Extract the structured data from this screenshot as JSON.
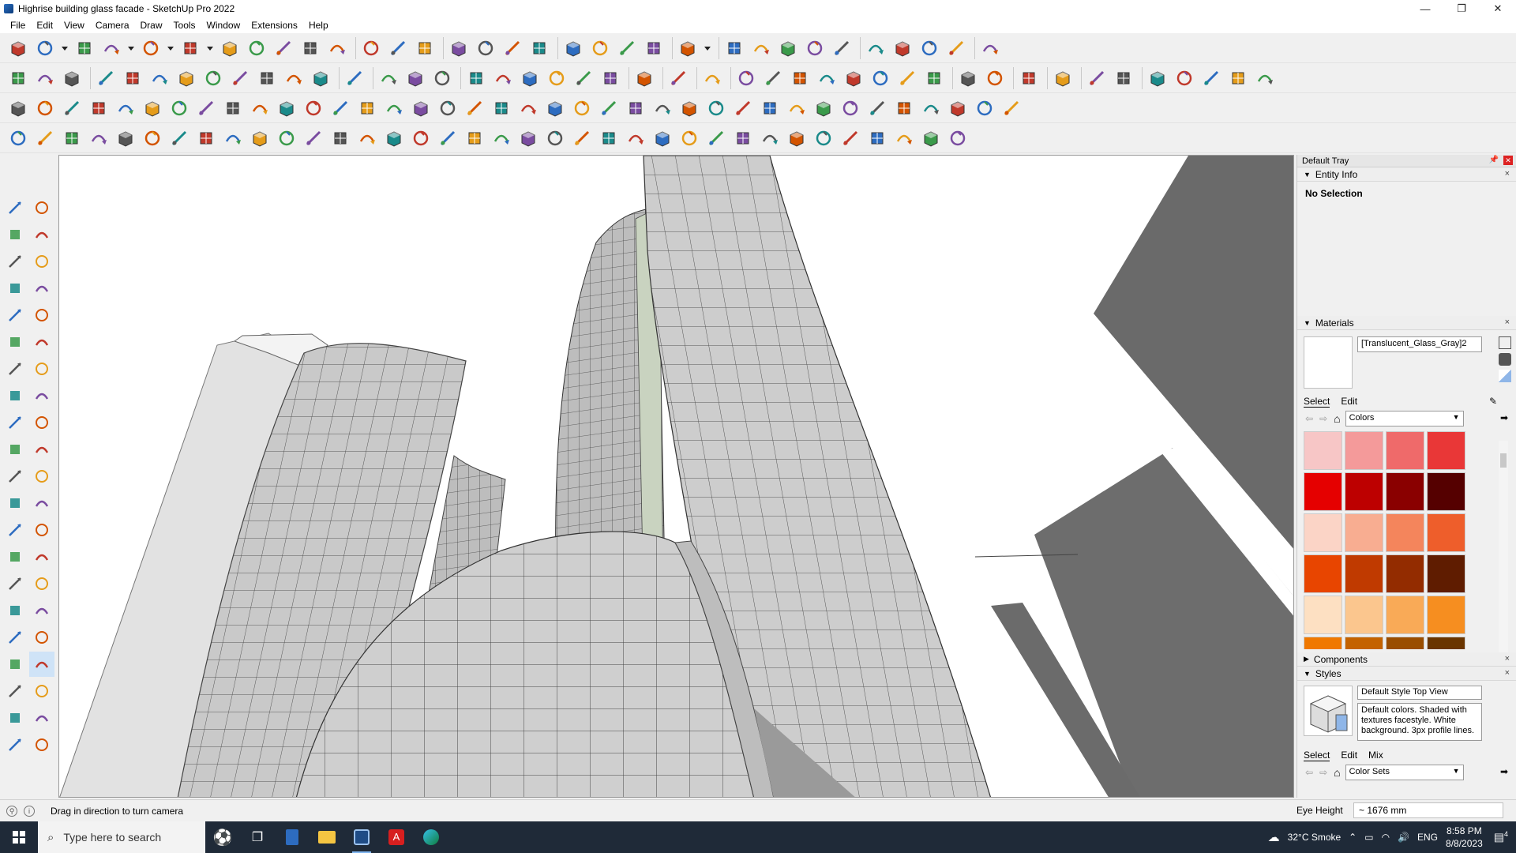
{
  "window": {
    "title": "Highrise building glass facade - SketchUp Pro 2022",
    "controls": {
      "minimize": "—",
      "restore": "❐",
      "close": "✕"
    }
  },
  "menu": [
    "File",
    "Edit",
    "View",
    "Camera",
    "Draw",
    "Tools",
    "Window",
    "Extensions",
    "Help"
  ],
  "tray": {
    "title": "Default Tray",
    "entity_info": {
      "header": "Entity Info",
      "selection": "No Selection"
    },
    "materials": {
      "header": "Materials",
      "name": "[Translucent_Glass_Gray]2",
      "tabs": [
        "Select",
        "Edit"
      ],
      "library": "Colors",
      "swatches": [
        "#f7c6c6",
        "#f49a9a",
        "#ef6a6a",
        "#e93737",
        "#e50000",
        "#bd0000",
        "#8a0000",
        "#550000",
        "#fbd4c6",
        "#f8ad91",
        "#f4855c",
        "#ee5e2b",
        "#e84500",
        "#c03a00",
        "#932c00",
        "#5f1c00",
        "#fde0c2",
        "#fbc68e",
        "#f9aa57",
        "#f68e20",
        "#f07800",
        "#c46200",
        "#9a4d00",
        "#6a3500"
      ]
    },
    "components": {
      "header": "Components"
    },
    "styles": {
      "header": "Styles",
      "name": "Default Style Top View",
      "description": "Default colors.  Shaded with textures facestyle.  White background.  3px profile lines.",
      "tabs": [
        "Select",
        "Edit",
        "Mix"
      ],
      "library": "Color Sets"
    }
  },
  "status": {
    "message": "Drag in direction to turn camera",
    "eye_height_label": "Eye Height",
    "eye_height_value": "~ 1676 mm"
  },
  "taskbar": {
    "search_placeholder": "Type here to search",
    "weather": "32°C  Smoke",
    "language": "ENG",
    "time": "8:58 PM",
    "date": "8/8/2023",
    "notifications": "4"
  }
}
